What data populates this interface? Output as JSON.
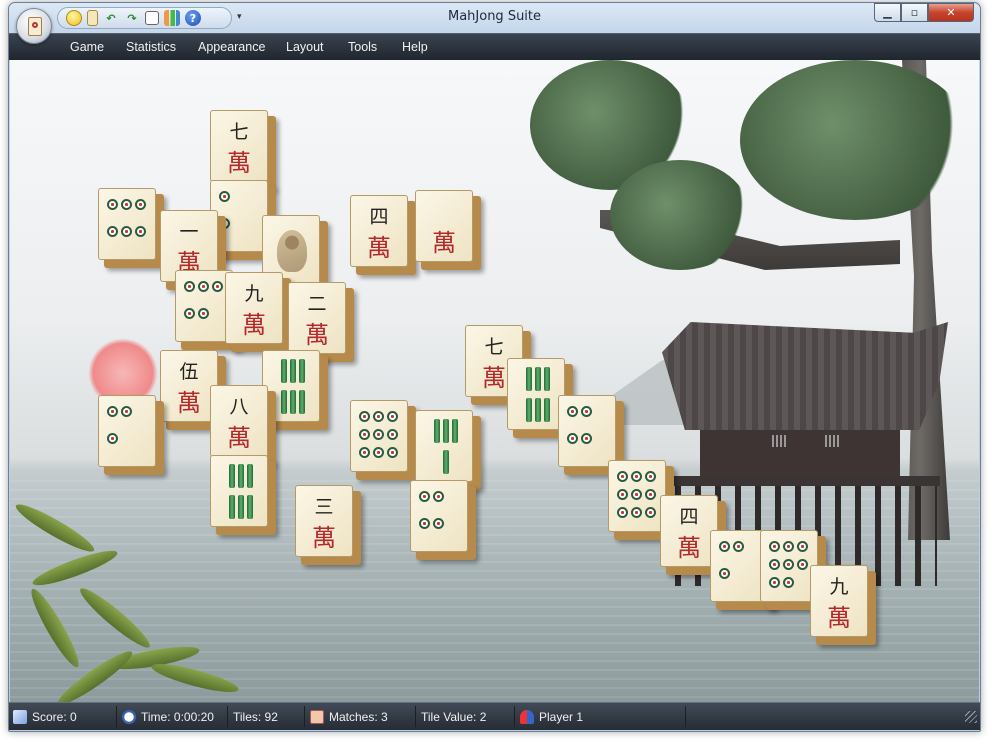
{
  "window": {
    "title": "MahJong Suite"
  },
  "quick_access_toolbar": {
    "buttons": [
      "smiley-new-game-icon",
      "card-icon",
      "undo-icon",
      "redo-icon",
      "hint-icon",
      "statistics-chart-icon",
      "help-icon"
    ],
    "help_label": "?",
    "more_label": "▾"
  },
  "caption_buttons": {
    "minimize": "▁",
    "maximize": "▫",
    "close": "✕"
  },
  "menu": {
    "items": [
      "Game",
      "Statistics",
      "Appearance",
      "Layout",
      "Tools",
      "Help"
    ]
  },
  "board": {
    "tiles": [
      {
        "type": "char",
        "top": "七",
        "bottom": "萬"
      },
      {
        "type": "dots",
        "count": 2
      },
      {
        "type": "dots",
        "count": 6
      },
      {
        "type": "char",
        "top": "一",
        "bottom": "萬"
      },
      {
        "type": "bird"
      },
      {
        "type": "dots",
        "count": 5
      },
      {
        "type": "char",
        "top": "九",
        "bottom": "萬"
      },
      {
        "type": "char",
        "top": "二",
        "bottom": "萬"
      },
      {
        "type": "char",
        "top": "四",
        "bottom": "萬"
      },
      {
        "type": "char",
        "top": "伍",
        "bottom": "萬"
      },
      {
        "type": "bams",
        "count": 6
      },
      {
        "type": "dots",
        "count": 3
      },
      {
        "type": "char",
        "top": "八",
        "bottom": "萬"
      },
      {
        "type": "dots",
        "count": 9
      },
      {
        "type": "bams",
        "count": 4
      },
      {
        "type": "char",
        "top": "七",
        "bottom": "萬"
      },
      {
        "type": "bams",
        "count": 6
      },
      {
        "type": "dots",
        "count": 4
      },
      {
        "type": "dots",
        "count": 9
      },
      {
        "type": "char",
        "top": "四",
        "bottom": "萬"
      },
      {
        "type": "dots",
        "count": 3
      },
      {
        "type": "dots",
        "count": 8
      },
      {
        "type": "char",
        "top": "九",
        "bottom": "萬"
      },
      {
        "type": "bams",
        "count": 6
      },
      {
        "type": "char",
        "top": "",
        "bottom": "萬"
      },
      {
        "type": "char",
        "top": "三",
        "bottom": "萬"
      },
      {
        "type": "dots",
        "count": 4
      }
    ]
  },
  "status": {
    "score": "Score: 0",
    "time": "Time: 0:00:20",
    "tiles": "Tiles: 92",
    "matches": "Matches: 3",
    "tile_value": "Tile Value: 2",
    "player": "Player 1"
  }
}
